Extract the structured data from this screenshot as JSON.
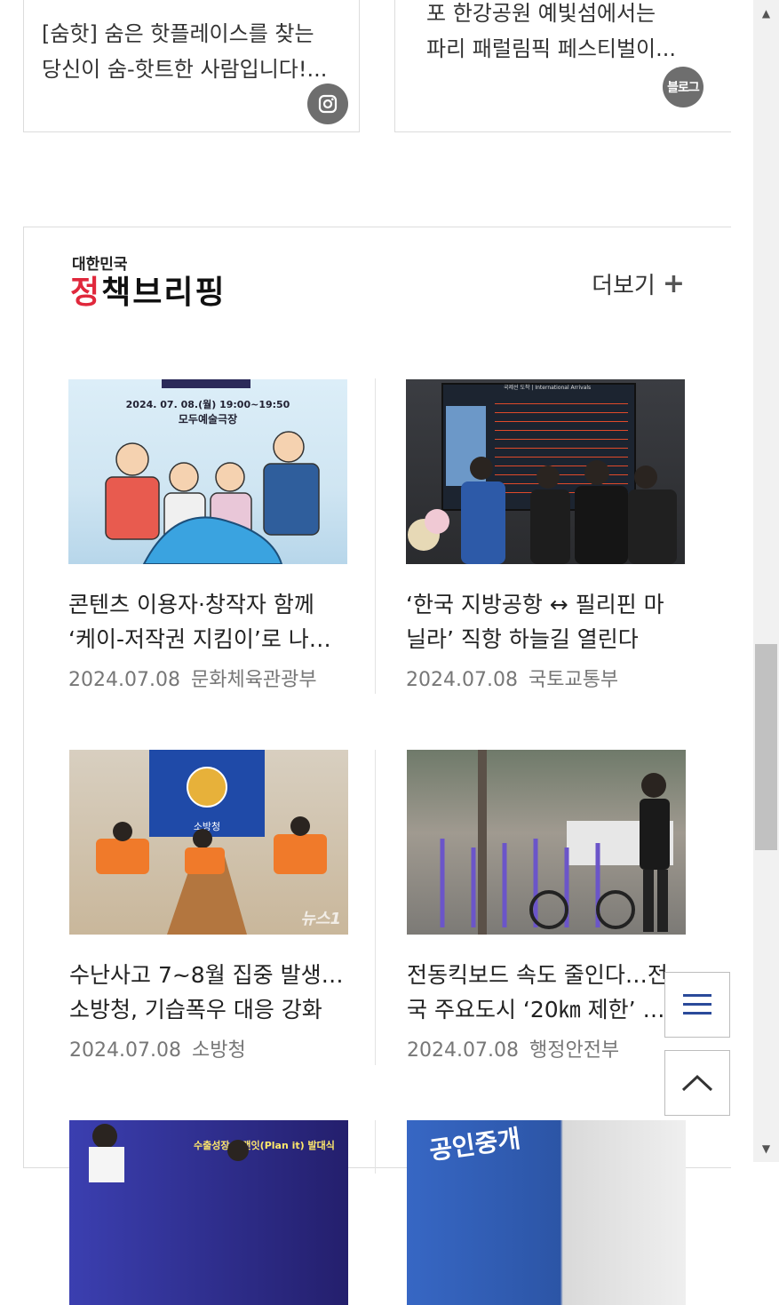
{
  "top_cards": [
    {
      "lines": [
        "[숨핫] 숨은 핫플레이스를 찾는",
        "당신이 숨-핫트한 사람입니다!..."
      ],
      "sns": "instagram-icon"
    },
    {
      "lines": [
        "포 한강공원 예빛섬에서는",
        "파리 패럴림픽 페스티벌이..."
      ],
      "sns_label": "블로그"
    }
  ],
  "briefing": {
    "logo_small": "대한민국",
    "logo_main_parts": [
      "정",
      "책브리핑"
    ],
    "more_label": "더보기",
    "items": [
      {
        "title_lines": [
          "콘텐츠 이용자·창작자 함께",
          "‘케이-저작권 지킴이’로 나…"
        ],
        "date": "2024.07.08",
        "source": "문화체육관광부",
        "thumb_caption_1": "2024. 07. 08.(월) 19:00~19:50",
        "thumb_caption_2": "모두예술극장"
      },
      {
        "title_lines": [
          "‘한국 지방공항 ↔ 필리핀 마",
          "닐라’ 직항 하늘길 열린다"
        ],
        "date": "2024.07.08",
        "source": "국토교통부",
        "thumb_caption_1": "국제선 도착 | International Arrivals"
      },
      {
        "title_lines": [
          "수난사고 7~8월 집중 발생…",
          "소방청, 기습폭우 대응 강화"
        ],
        "date": "2024.07.08",
        "source": "소방청",
        "thumb_caption_1": "소방청",
        "thumb_caption_2": "뉴스1"
      },
      {
        "title_lines": [
          "전동킥보드 속도 줄인다…전",
          "국 주요도시 ‘20㎞ 제한’ …"
        ],
        "date": "2024.07.08",
        "source": "행정안전부"
      },
      {
        "thumb_caption_1": "수출성장 플랜잇(Plan it) 발대식"
      },
      {
        "thumb_caption_1": "공인중개"
      }
    ]
  }
}
